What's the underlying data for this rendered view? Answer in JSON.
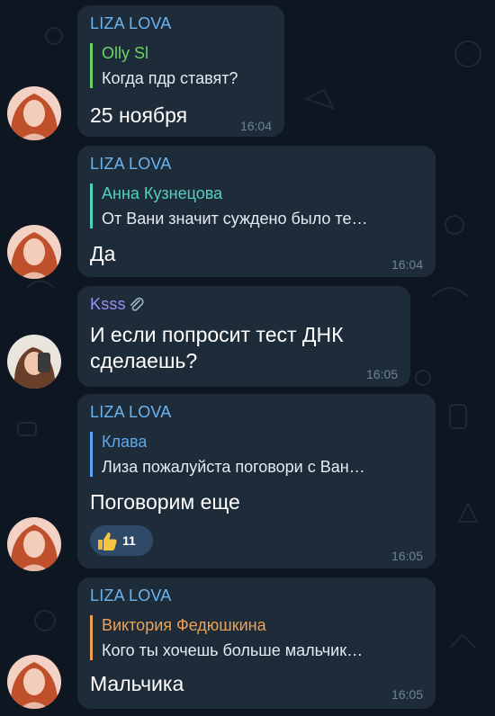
{
  "messages": [
    {
      "sender": "LIZA LOVA",
      "reply_name": "Olly Sl",
      "reply_text": "Когда пдр ставят?",
      "text": "25 ноября",
      "time": "16:04",
      "reply_color": "#6bd36b"
    },
    {
      "sender": "LIZA LOVA",
      "reply_name": "Анна Кузнецова",
      "reply_text": "От Вани значит суждено было те…",
      "text": "Да",
      "time": "16:04",
      "reply_color": "#4fd1c5"
    },
    {
      "sender": "Ksss",
      "sender_icon": "paperclip-icon",
      "text_line1": "И если попросит тест ДНК",
      "text_line2": "сделаешь?",
      "time": "16:05",
      "sender_color": "#9b8ff2"
    },
    {
      "sender": "LIZA LOVA",
      "reply_name": "Клава",
      "reply_text": "Лиза пожалуйста поговори с Ван…",
      "text": "Поговорим еще",
      "time": "16:05",
      "reply_color": "#5aa9f0",
      "reaction": {
        "emoji": "thumbs-up-icon",
        "count": "11"
      }
    },
    {
      "sender": "LIZA LOVA",
      "reply_name": "Виктория Федюшкина",
      "reply_text": "Кого ты хочешь больше мальчик…",
      "text": "Мальчика",
      "time": "16:05",
      "reply_color": "#f0a050"
    }
  ]
}
